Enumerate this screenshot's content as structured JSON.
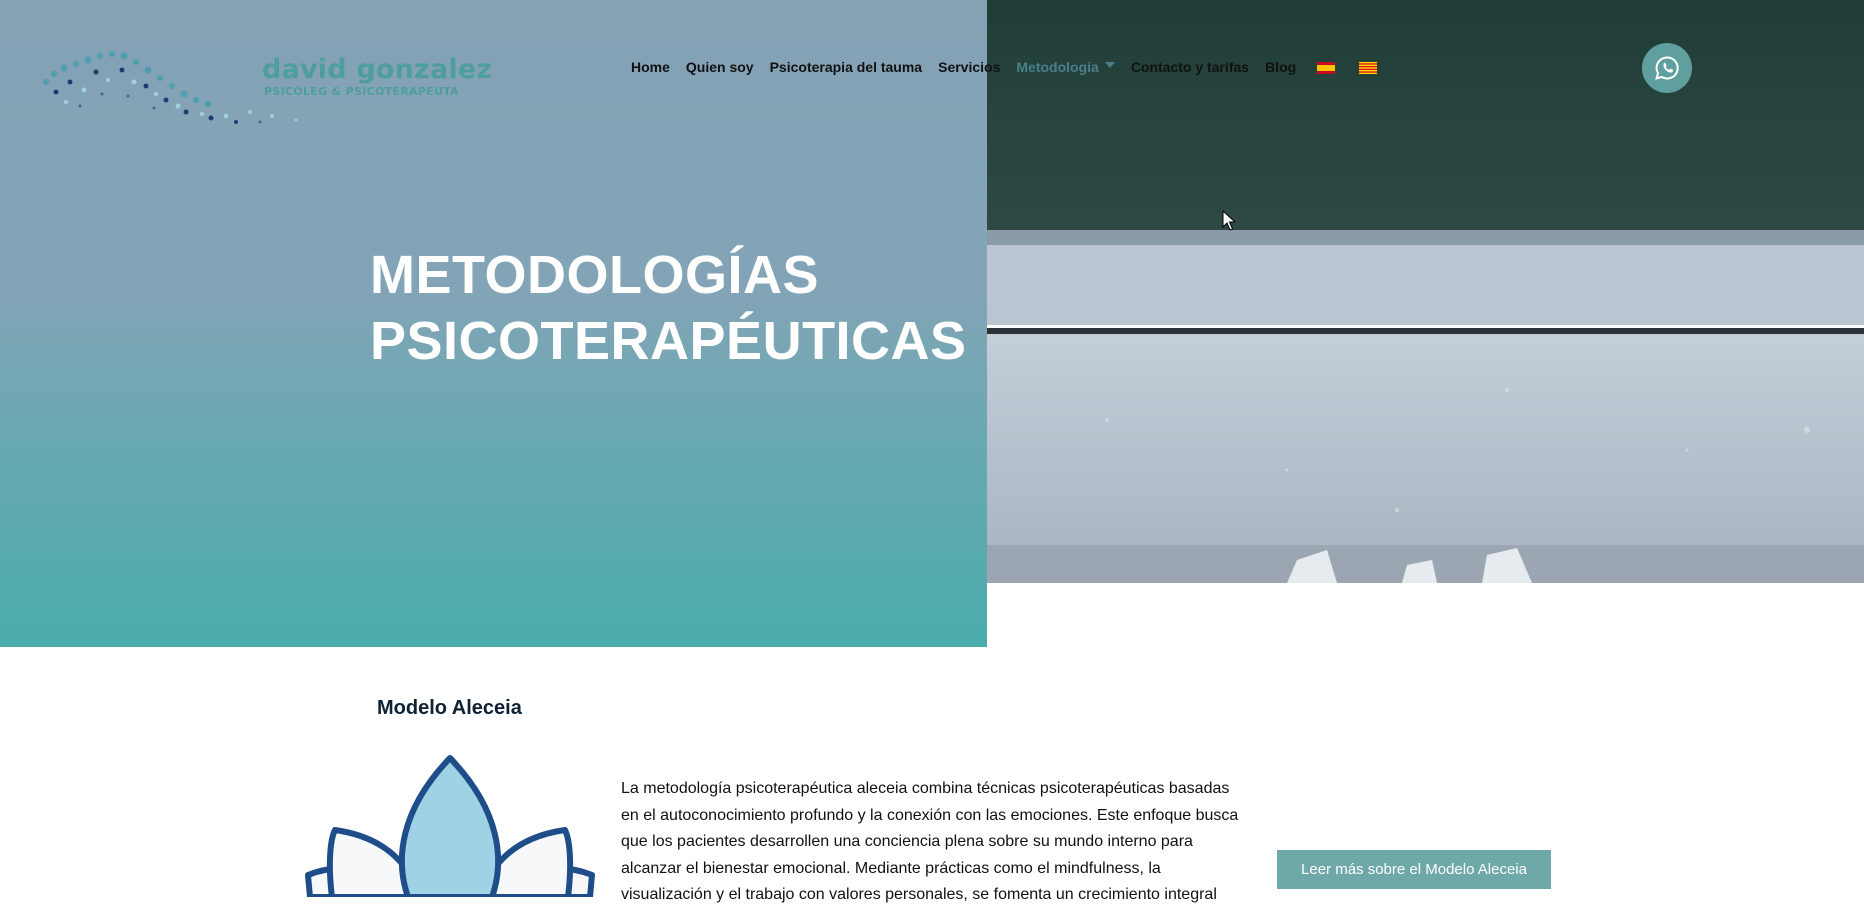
{
  "logo": {
    "name": "david gonzalez",
    "subtitle": "PSICÒLEG & PSICOTERAPEUTA"
  },
  "nav": {
    "items": [
      "Home",
      "Quien soy",
      "Psicoterapia del tauma",
      "Servicios",
      "Metodologia",
      "Contacto y tarifas",
      "Blog"
    ],
    "active": "Metodologia",
    "languages": [
      "es-flag-icon",
      "ca-flag-icon"
    ]
  },
  "hero": {
    "title_line1": "METODOLOGÍAS",
    "title_line2": "PSICOTERAPÉUTICAS"
  },
  "section": {
    "title": "Modelo Aleceia",
    "body": "La metodología psicoterapéutica aleceia combina técnicas psicoterapéuticas basadas en el autoconocimiento profundo y la conexión con las emociones. Este enfoque busca que los pacientes desarrollen una conciencia plena sobre su mundo interno para alcanzar el bienestar emocional. Mediante prácticas como el mindfulness, la visualización y el trabajo con valores personales, se fomenta un crecimiento integral",
    "button_label": "Leer más sobre el Modelo Aleceia"
  },
  "colors": {
    "brand_teal": "#4e9e9e",
    "button": "#6fa8a8",
    "hero_gradient_top": "#85a2b5",
    "hero_gradient_bottom": "#4aacab"
  },
  "icons": [
    "whatsapp-icon",
    "lotus-icon",
    "cursor-icon"
  ]
}
